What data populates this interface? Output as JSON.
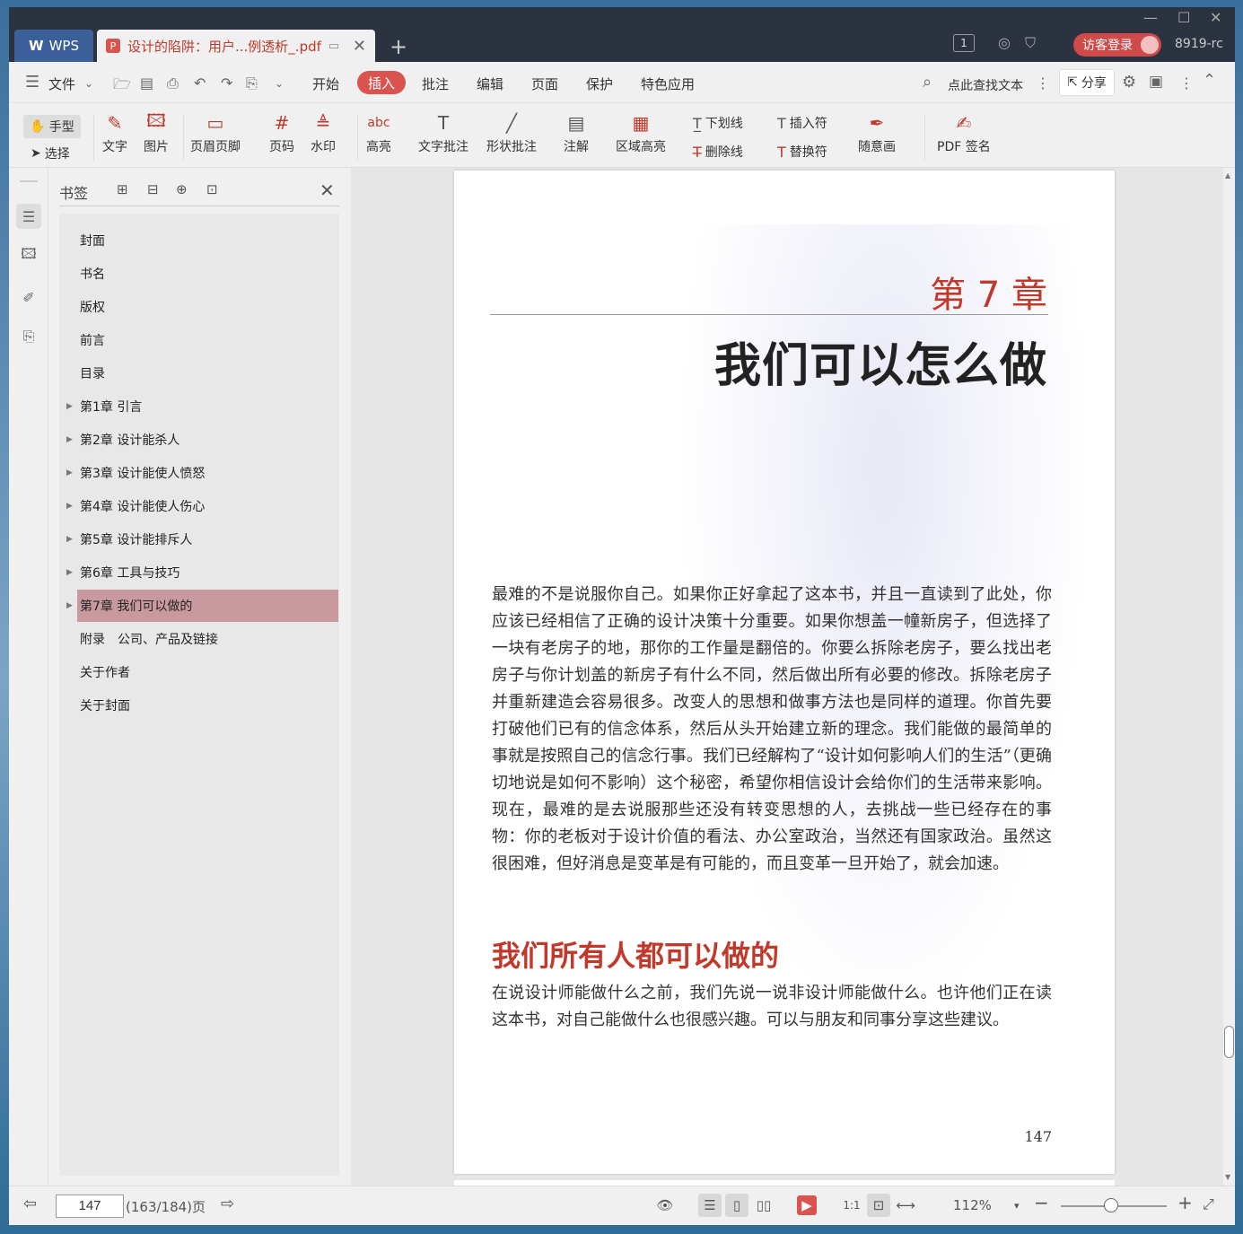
{
  "titlebar": {
    "app_tab": "WPS",
    "doc_tab": "设计的陷阱：用户...例透析_.pdf",
    "page_badge": "1",
    "visitor_login": "访客登录",
    "user_id": "8919-rc"
  },
  "menu": {
    "file": "文件",
    "items": [
      "开始",
      "插入",
      "批注",
      "编辑",
      "页面",
      "保护",
      "特色应用"
    ],
    "active": "插入",
    "search": "点此查找文本",
    "share": "分享"
  },
  "toolbar": {
    "hand": "手型",
    "select": "选择",
    "text": "文字",
    "image": "图片",
    "header_footer": "页眉页脚",
    "page_number": "页码",
    "watermark": "水印",
    "highlight": "高亮",
    "text_annotation": "文字批注",
    "shape_annotation": "形状批注",
    "note": "注解",
    "area_highlight": "区域高亮",
    "underline": "下划线",
    "strikethrough": "删除线",
    "insert_mark": "插入符",
    "replace_mark": "替换符",
    "freehand": "随意画",
    "pdf_sign": "PDF 签名"
  },
  "bookmarks": {
    "title": "书签",
    "items": [
      {
        "label": "封面",
        "expandable": false
      },
      {
        "label": "书名",
        "expandable": false
      },
      {
        "label": "版权",
        "expandable": false
      },
      {
        "label": "前言",
        "expandable": false
      },
      {
        "label": "目录",
        "expandable": false
      },
      {
        "label": "第1章 引言",
        "expandable": true
      },
      {
        "label": "第2章 设计能杀人",
        "expandable": true
      },
      {
        "label": "第3章 设计能使人愤怒",
        "expandable": true
      },
      {
        "label": "第4章 设计能使人伤心",
        "expandable": true
      },
      {
        "label": "第5章 设计能排斥人",
        "expandable": true
      },
      {
        "label": "第6章 工具与技巧",
        "expandable": true
      },
      {
        "label": "第7章 我们可以做的",
        "expandable": true
      },
      {
        "label": "附录　公司、产品及链接",
        "expandable": false
      },
      {
        "label": "关于作者",
        "expandable": false
      },
      {
        "label": "关于封面",
        "expandable": false
      }
    ],
    "selected_index": 11
  },
  "page": {
    "chapter_number": "第 7 章",
    "chapter_title": "我们可以怎么做",
    "paragraph1": "最难的不是说服你自己。如果你正好拿起了这本书，并且一直读到了此处，你应该已经相信了正确的设计决策十分重要。如果你想盖一幢新房子，但选择了一块有老房子的地，那你的工作量是翻倍的。你要么拆除老房子，要么找出老房子与你计划盖的新房子有什么不同，然后做出所有必要的修改。拆除老房子并重新建造会容易很多。改变人的思想和做事方法也是同样的道理。你首先要打破他们已有的信念体系，然后从头开始建立新的理念。我们能做的最简单的事就是按照自己的信念行事。我们已经解构了“设计如何影响人们的生活”（更确切地说是如何不影响）这个秘密，希望你相信设计会给你们的生活带来影响。现在，最难的是去说服那些还没有转变思想的人，去挑战一些已经存在的事物：你的老板对于设计价值的看法、办公室政治，当然还有国家政治。虽然这很困难，但好消息是变革是有可能的，而且变革一旦开始了，就会加速。",
    "section_title": "我们所有人都可以做的",
    "paragraph2": "在说设计师能做什么之前，我们先说一说非设计师能做什么。也许他们正在读这本书，对自己能做什么也很感兴趣。可以与朋友和同事分享这些建议。",
    "page_number": "147"
  },
  "status": {
    "current_page": "147",
    "page_info": "(163/184)页",
    "zoom": "112%"
  },
  "colors": {
    "accent": "#d9534f",
    "chapter_red": "#c0392b",
    "selected_bookmark": "#c89aa0"
  }
}
